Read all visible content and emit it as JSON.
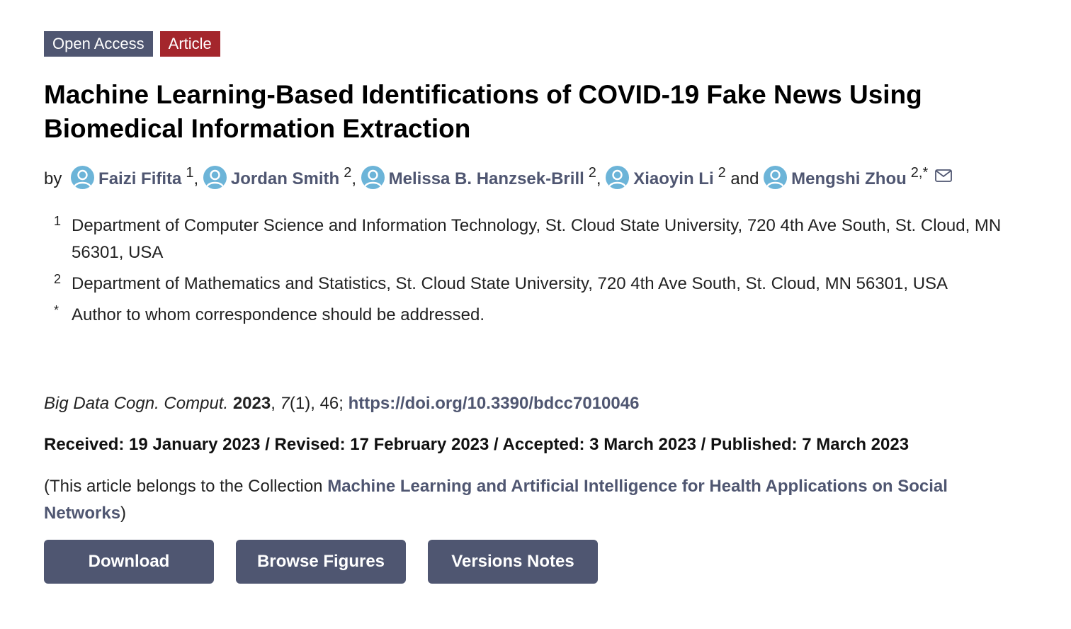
{
  "badges": {
    "open_access": "Open Access",
    "article": "Article"
  },
  "title": "Machine Learning-Based Identifications of COVID-19 Fake News Using Biomedical Information Extraction",
  "authors": {
    "by": "by",
    "and": "and",
    "list": [
      {
        "name": "Faizi Fifita",
        "sup": "1",
        "sep": ","
      },
      {
        "name": "Jordan Smith",
        "sup": "2",
        "sep": ","
      },
      {
        "name": "Melissa B. Hanzsek-Brill",
        "sup": "2",
        "sep": ","
      },
      {
        "name": "Xiaoyin Li",
        "sup": "2",
        "sep": ""
      },
      {
        "name": "Mengshi Zhou",
        "sup": "2,*",
        "sep": ""
      }
    ]
  },
  "affiliations": [
    {
      "num": "1",
      "text": "Department of Computer Science and Information Technology, St. Cloud State University, 720 4th Ave South, St. Cloud, MN 56301, USA"
    },
    {
      "num": "2",
      "text": "Department of Mathematics and Statistics, St. Cloud State University, 720 4th Ave South, St. Cloud, MN 56301, USA"
    },
    {
      "num": "*",
      "text": "Author to whom correspondence should be addressed."
    }
  ],
  "citation": {
    "journal": "Big Data Cogn. Comput.",
    "year": "2023",
    "volume": "7",
    "rest": "(1), 46;",
    "doi": "https://doi.org/10.3390/bdcc7010046"
  },
  "dates": "Received: 19 January 2023 / Revised: 17 February 2023 / Accepted: 3 March 2023 / Published: 7 March 2023",
  "collection": {
    "prefix": "(This article belongs to the Collection ",
    "link": "Machine Learning and Artificial Intelligence for Health Applications on Social Networks",
    "suffix": ")"
  },
  "buttons": {
    "download": "Download",
    "browse_figures": "Browse Figures",
    "versions_notes": "Versions Notes"
  },
  "colors": {
    "accent": "#4f5671",
    "article_badge": "#a4262c",
    "avatar": "#6cb4d8"
  }
}
